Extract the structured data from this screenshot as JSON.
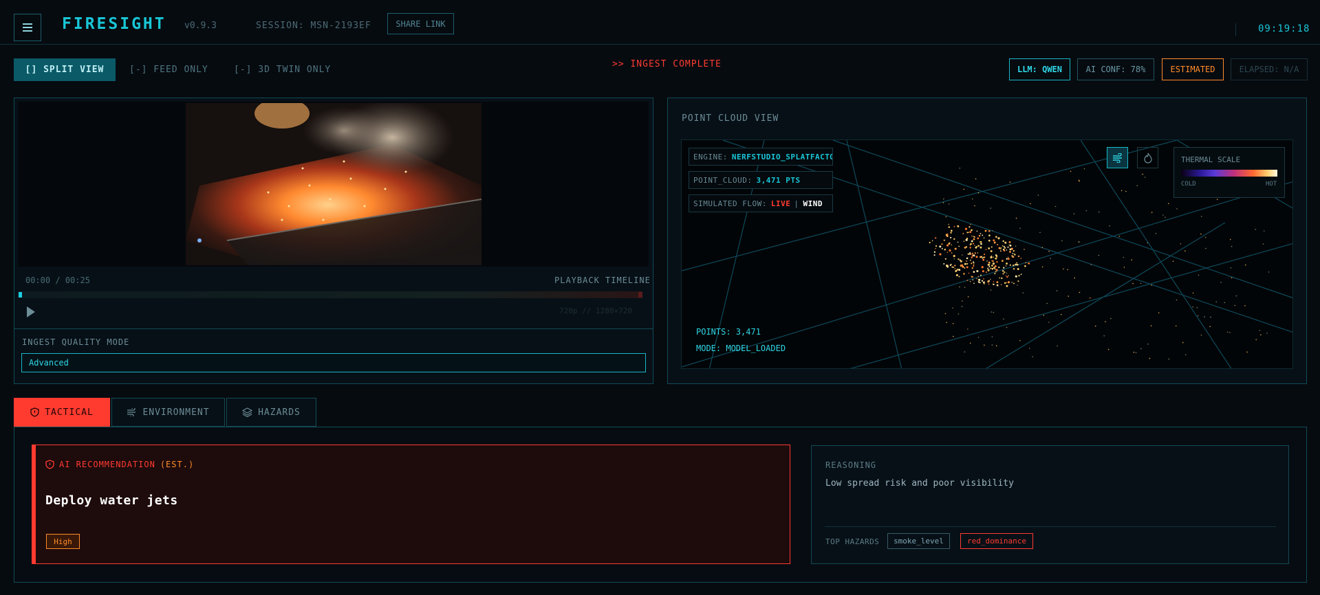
{
  "header": {
    "brand": "FIRESIGHT",
    "version": "v0.9.3",
    "session": "SESSION: MSN-2193EF",
    "share_label": "SHARE LINK",
    "clock": "09:19:18"
  },
  "view_tabs": [
    {
      "label": "[] SPLIT VIEW",
      "active": true
    },
    {
      "label": "[-] FEED ONLY",
      "active": false
    },
    {
      "label": "[-] 3D TWIN ONLY",
      "active": false
    }
  ],
  "status": ">> INGEST COMPLETE",
  "chips": {
    "llm": "LLM: QWEN",
    "ai_conf": "AI CONF: 78%",
    "estimated": "ESTIMATED",
    "elapsed": "ELAPSED: N/A"
  },
  "video": {
    "time": "00:00 / 00:25",
    "timeline_label": "PLAYBACK TIMELINE",
    "resolution": "720p // 1280×720",
    "progress": 0.0
  },
  "ingest": {
    "label": "INGEST QUALITY MODE",
    "value": "Advanced"
  },
  "point_cloud": {
    "title": "POINT CLOUD VIEW",
    "engine_label": "ENGINE:",
    "engine_value": "NERFSTUDIO_SPLATFACTO",
    "cloud_label": "POINT_CLOUD:",
    "cloud_value": "3,471 PTS",
    "flow_label": "SIMULATED FLOW:",
    "flow_live": "LIVE",
    "flow_sep": "|",
    "flow_wind": "WIND",
    "thermal_title": "THERMAL SCALE",
    "thermal_cold": "COLD",
    "thermal_hot": "HOT",
    "points": "POINTS: 3,471",
    "mode": "MODE: MODEL_LOADED"
  },
  "bottom_tabs": [
    {
      "label": "TACTICAL",
      "icon": "shield-icon",
      "active": true
    },
    {
      "label": "ENVIRONMENT",
      "icon": "wind-icon",
      "active": false
    },
    {
      "label": "HAZARDS",
      "icon": "layers-icon",
      "active": false
    }
  ],
  "recommendation": {
    "heading": "AI RECOMMENDATION",
    "heading_suffix": "(EST.)",
    "title": "Deploy water jets",
    "priority": "High"
  },
  "reasoning": {
    "label": "REASONING",
    "text": "Low spread risk and poor visibility",
    "hazards_label": "TOP HAZARDS",
    "hazards": [
      "smoke_level",
      "red_dominance"
    ]
  },
  "colors": {
    "accent": "#19c6d6",
    "alert": "#ff3b30",
    "warning": "#ff8c2a",
    "background": "#060b10"
  }
}
